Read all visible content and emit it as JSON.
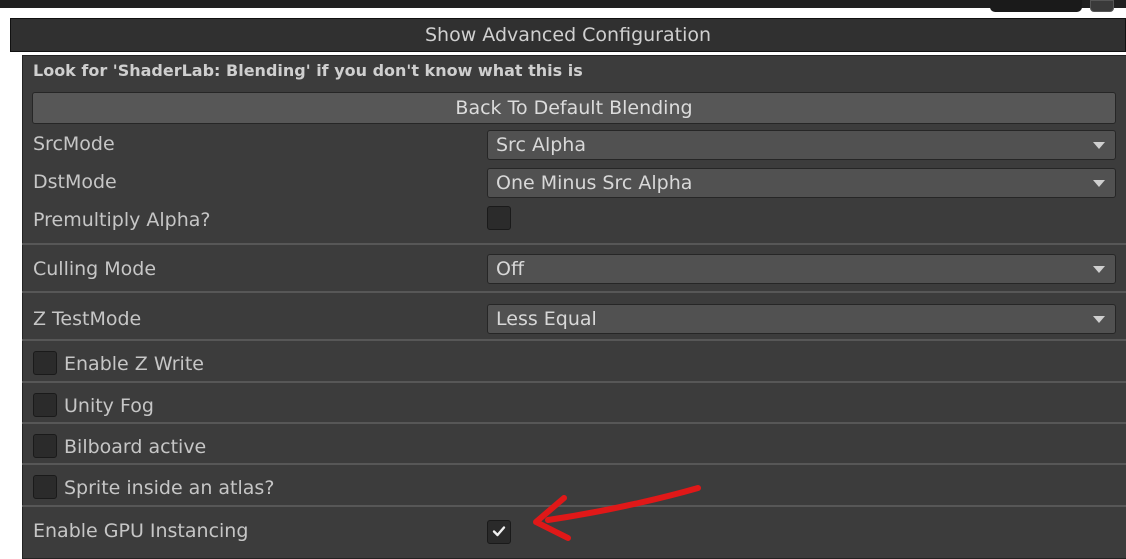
{
  "advanced_button": "Show Advanced Configuration",
  "blending_note": "Look for 'ShaderLab: Blending' if you don't know what this is",
  "default_blending_button": "Back To Default Blending",
  "src_mode": {
    "label": "SrcMode",
    "value": "Src Alpha"
  },
  "dst_mode": {
    "label": "DstMode",
    "value": "One Minus Src Alpha"
  },
  "premultiply": {
    "label": "Premultiply Alpha?",
    "checked": false
  },
  "culling": {
    "label": "Culling Mode",
    "value": "Off"
  },
  "ztest": {
    "label": "Z TestMode",
    "value": "Less Equal"
  },
  "toggles": [
    {
      "label": "Enable Z Write",
      "checked": false
    },
    {
      "label": "Unity Fog",
      "checked": false
    },
    {
      "label": "Bilboard active",
      "checked": false
    },
    {
      "label": "Sprite inside an atlas?",
      "checked": false
    }
  ],
  "gpu_instancing": {
    "label": "Enable GPU Instancing",
    "checked": true
  },
  "colors": {
    "annotation_arrow": "#e01818",
    "panel_bg": "#3c3c3c"
  },
  "icons": {
    "dropdown": "chevron-down-icon",
    "check": "checkmark-icon",
    "annotation": "red-arrow-icon"
  }
}
